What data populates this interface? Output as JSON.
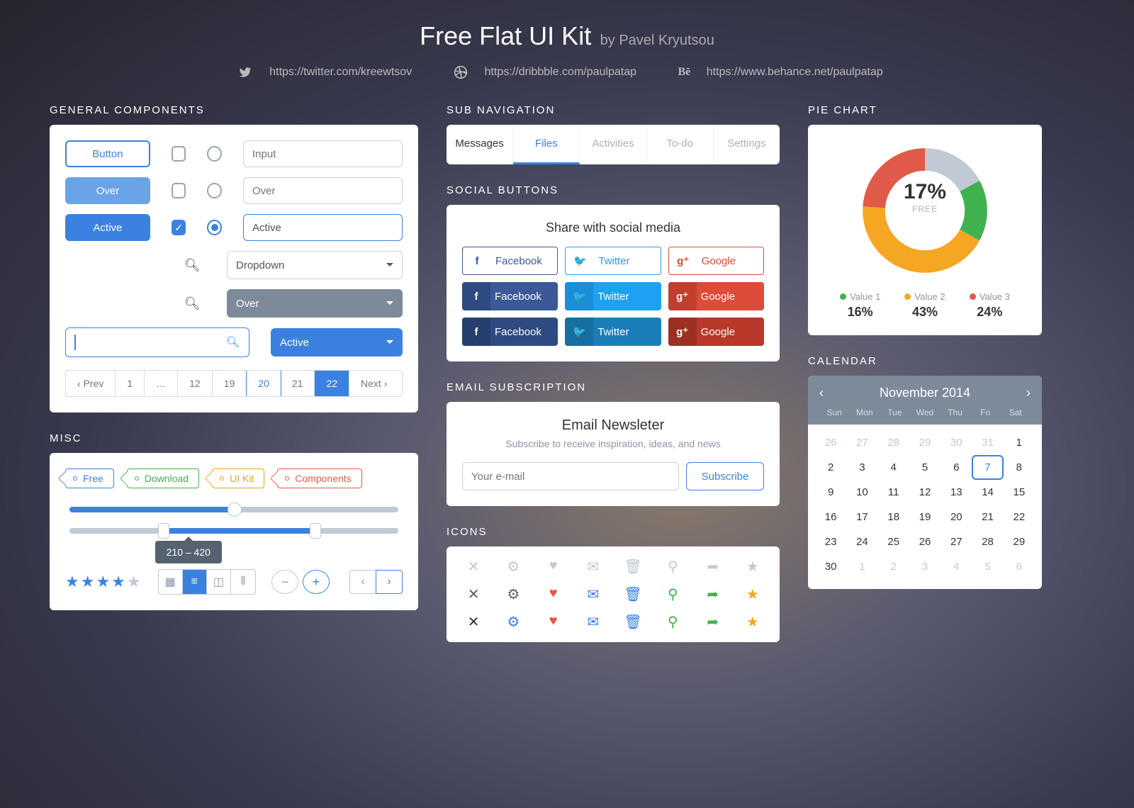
{
  "header": {
    "title": "Free Flat UI Kit",
    "by": "by Pavel Kryutsou"
  },
  "links": {
    "twitter": "https://twitter.com/kreewtsov",
    "dribbble": "https://dribbble.com/paulpatap",
    "behance": "https://www.behance.net/paulpatap"
  },
  "sections": {
    "general": "GENERAL COMPONENTS",
    "misc": "MISC",
    "subnav": "SUB NAVIGATION",
    "social": "SOCIAL BUTTONS",
    "email": "EMAIL SUBSCRIPTION",
    "icons": "ICONS",
    "pie": "PIE CHART",
    "calendar": "CALENDAR"
  },
  "general": {
    "buttons": {
      "default": "Button",
      "over": "Over",
      "active": "Active"
    },
    "inputs": {
      "default": "Input",
      "over": "Over",
      "active": "Active"
    },
    "dropdowns": {
      "default": "Dropdown",
      "over": "Over",
      "active": "Active"
    },
    "pagination": {
      "prev": "‹ Prev",
      "next": "Next ›",
      "pages": [
        "1",
        "…",
        "12",
        "19",
        "20",
        "21",
        "22"
      ]
    }
  },
  "misc": {
    "tags": [
      "Free",
      "Download",
      "UI Kit",
      "Components"
    ],
    "range_tooltip": "210 – 420",
    "slider1_pct": 50,
    "slider2_low": 28,
    "slider2_high": 74,
    "rating": 4
  },
  "subnav": {
    "items": [
      "Messages",
      "Files",
      "Activities",
      "To-do",
      "Settings"
    ],
    "current": 0,
    "active": 1
  },
  "social": {
    "title": "Share with social media",
    "fb": "Facebook",
    "tw": "Twitter",
    "gg": "Google"
  },
  "email": {
    "title": "Email Newsleter",
    "sub": "Subscribe to receive inspiration, ideas, and news",
    "placeholder": "Your e-mail",
    "button": "Subscribe"
  },
  "icons": {
    "names": [
      "close",
      "gear",
      "heart",
      "mail",
      "trash",
      "pin",
      "share",
      "star"
    ]
  },
  "pie": {
    "center_value": "17%",
    "center_label": "FREE",
    "legend": [
      {
        "name": "Value 1",
        "pct": "16%",
        "color": "#3fb24f"
      },
      {
        "name": "Value 2",
        "pct": "43%",
        "color": "#f5a623"
      },
      {
        "name": "Value 3",
        "pct": "24%",
        "color": "#e05a47"
      }
    ]
  },
  "calendar": {
    "month": "November 2014",
    "days": [
      "Sun",
      "Mon",
      "Tue",
      "Wed",
      "Thu",
      "Fri",
      "Sat"
    ],
    "weeks": [
      [
        {
          "n": 26,
          "m": 1
        },
        {
          "n": 27,
          "m": 1
        },
        {
          "n": 28,
          "m": 1
        },
        {
          "n": 29,
          "m": 1
        },
        {
          "n": 30,
          "m": 1
        },
        {
          "n": 31,
          "m": 1
        },
        {
          "n": 1
        }
      ],
      [
        {
          "n": 2
        },
        {
          "n": 3
        },
        {
          "n": 4
        },
        {
          "n": 5
        },
        {
          "n": 6
        },
        {
          "n": 7,
          "t": 1
        },
        {
          "n": 8
        }
      ],
      [
        {
          "n": 9
        },
        {
          "n": 10
        },
        {
          "n": 11
        },
        {
          "n": 12
        },
        {
          "n": 13
        },
        {
          "n": 14
        },
        {
          "n": 15
        }
      ],
      [
        {
          "n": 16
        },
        {
          "n": 17
        },
        {
          "n": 18
        },
        {
          "n": 19
        },
        {
          "n": 20
        },
        {
          "n": 21
        },
        {
          "n": 22
        }
      ],
      [
        {
          "n": 23
        },
        {
          "n": 24
        },
        {
          "n": 25
        },
        {
          "n": 26
        },
        {
          "n": 27
        },
        {
          "n": 28
        },
        {
          "n": 29
        }
      ],
      [
        {
          "n": 30
        },
        {
          "n": 1,
          "m": 1
        },
        {
          "n": 2,
          "m": 1
        },
        {
          "n": 3,
          "m": 1
        },
        {
          "n": 4,
          "m": 1
        },
        {
          "n": 5,
          "m": 1
        },
        {
          "n": 6,
          "m": 1
        }
      ]
    ]
  },
  "chart_data": {
    "type": "pie",
    "title": "",
    "center": {
      "value": 17,
      "label": "FREE"
    },
    "series": [
      {
        "name": "Value 1",
        "value": 16,
        "color": "#3fb24f"
      },
      {
        "name": "Value 2",
        "value": 43,
        "color": "#f5a623"
      },
      {
        "name": "Value 3",
        "value": 24,
        "color": "#e05a47"
      },
      {
        "name": "Free",
        "value": 17,
        "color": "#c0c9d4"
      }
    ]
  }
}
